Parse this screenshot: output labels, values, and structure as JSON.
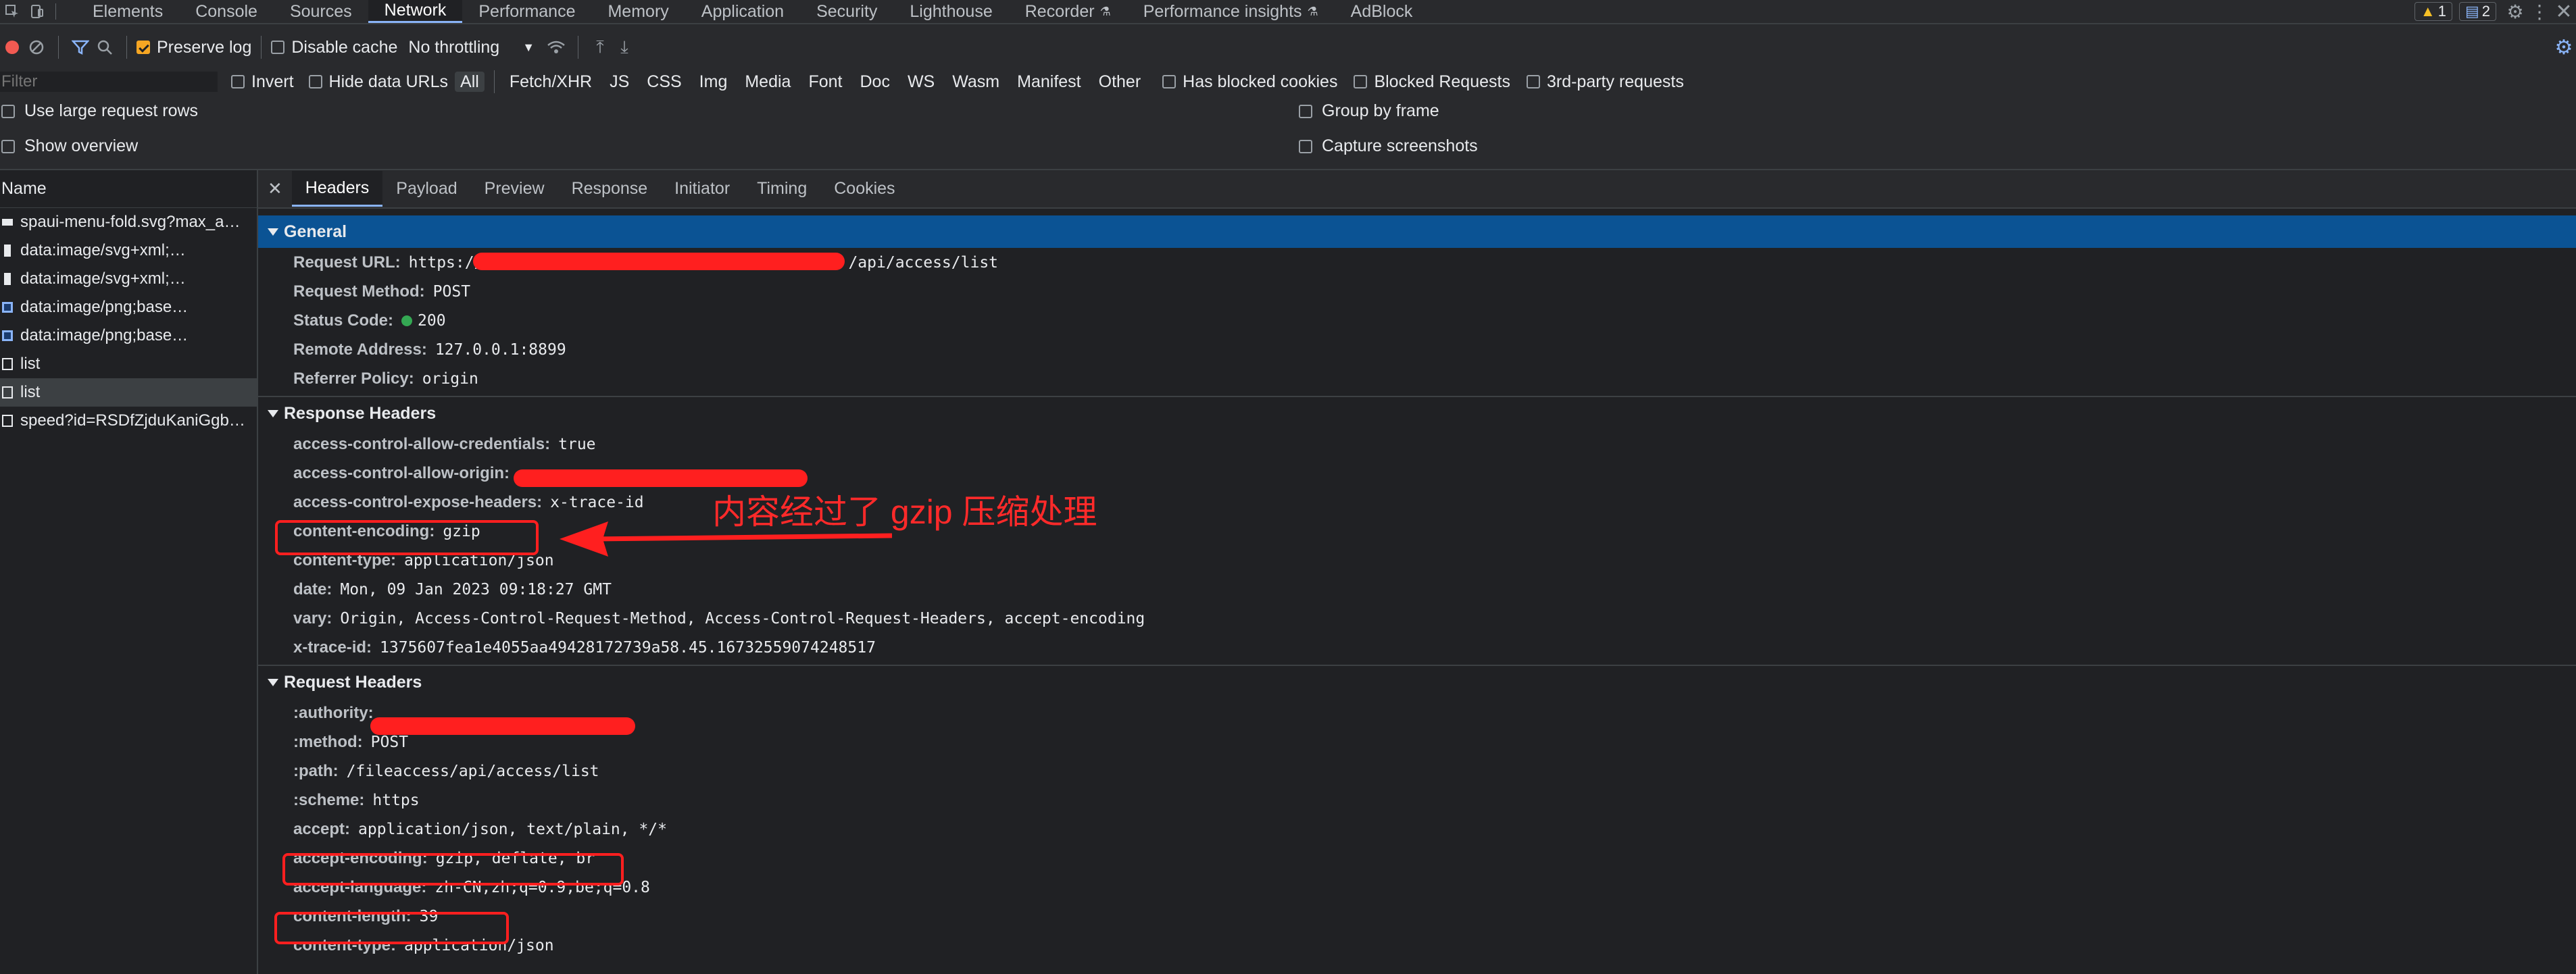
{
  "tabs": [
    "Elements",
    "Console",
    "Sources",
    "Network",
    "Performance",
    "Memory",
    "Application",
    "Security",
    "Lighthouse",
    "Recorder",
    "Performance insights",
    "AdBlock"
  ],
  "active_tab": "Network",
  "badges": {
    "warnings": "1",
    "messages": "2"
  },
  "toolbar": {
    "preserve_log": "Preserve log",
    "disable_cache": "Disable cache",
    "throttling": "No throttling"
  },
  "filter": {
    "placeholder": "Filter",
    "invert": "Invert",
    "hide_data_urls": "Hide data URLs",
    "types": [
      "All",
      "Fetch/XHR",
      "JS",
      "CSS",
      "Img",
      "Media",
      "Font",
      "Doc",
      "WS",
      "Wasm",
      "Manifest",
      "Other"
    ],
    "has_blocked_cookies": "Has blocked cookies",
    "blocked_requests": "Blocked Requests",
    "third_party": "3rd-party requests"
  },
  "settings": {
    "large_rows": "Use large request rows",
    "show_overview": "Show overview",
    "group_by_frame": "Group by frame",
    "capture_screenshots": "Capture screenshots"
  },
  "requests": {
    "header": "Name",
    "items": [
      "spaui-menu-fold.svg?max_a…",
      "data:image/svg+xml;…",
      "data:image/svg+xml;…",
      "data:image/png;base…",
      "data:image/png;base…",
      "list",
      "list",
      "speed?id=RSDfZjduKaniGgb…"
    ]
  },
  "detail_tabs": [
    "Headers",
    "Payload",
    "Preview",
    "Response",
    "Initiator",
    "Timing",
    "Cookies"
  ],
  "general": {
    "title": "General",
    "rows": [
      {
        "k": "Request URL:",
        "v": "https://"
      },
      {
        "k": "Request Method:",
        "v": "POST"
      },
      {
        "k": "Status Code:",
        "v": "200"
      },
      {
        "k": "Remote Address:",
        "v": "127.0.0.1:8899"
      },
      {
        "k": "Referrer Policy:",
        "v": "origin"
      }
    ],
    "url_suffix": "/api/access/list"
  },
  "response_headers": {
    "title": "Response Headers",
    "rows": [
      {
        "k": "access-control-allow-credentials:",
        "v": "true"
      },
      {
        "k": "access-control-allow-origin:",
        "v": ""
      },
      {
        "k": "access-control-expose-headers:",
        "v": "x-trace-id"
      },
      {
        "k": "content-encoding:",
        "v": "gzip"
      },
      {
        "k": "content-type:",
        "v": "application/json"
      },
      {
        "k": "date:",
        "v": "Mon, 09 Jan 2023 09:18:27 GMT"
      },
      {
        "k": "vary:",
        "v": "Origin, Access-Control-Request-Method, Access-Control-Request-Headers, accept-encoding"
      },
      {
        "k": "x-trace-id:",
        "v": "1375607fea1e4055aa49428172739a58.45.16732559074248517"
      }
    ]
  },
  "request_headers": {
    "title": "Request Headers",
    "rows": [
      {
        "k": ":authority:",
        "v": ""
      },
      {
        "k": ":method:",
        "v": "POST"
      },
      {
        "k": ":path:",
        "v": "/fileaccess/api/access/list"
      },
      {
        "k": ":scheme:",
        "v": "https"
      },
      {
        "k": "accept:",
        "v": "application/json, text/plain, */*"
      },
      {
        "k": "accept-encoding:",
        "v": "gzip, deflate, br"
      },
      {
        "k": "accept-language:",
        "v": "zh-CN,zh;q=0.9,be;q=0.8"
      },
      {
        "k": "content-length:",
        "v": "39"
      },
      {
        "k": "content-type:",
        "v": "application/json"
      }
    ]
  },
  "annotation": "内容经过了 gzip 压缩处理",
  "colors": {
    "redact": "#ff1f1f",
    "accent": "#8ab4f8",
    "general_bg": "#0b5394",
    "preserve_check": "#f6a623"
  }
}
